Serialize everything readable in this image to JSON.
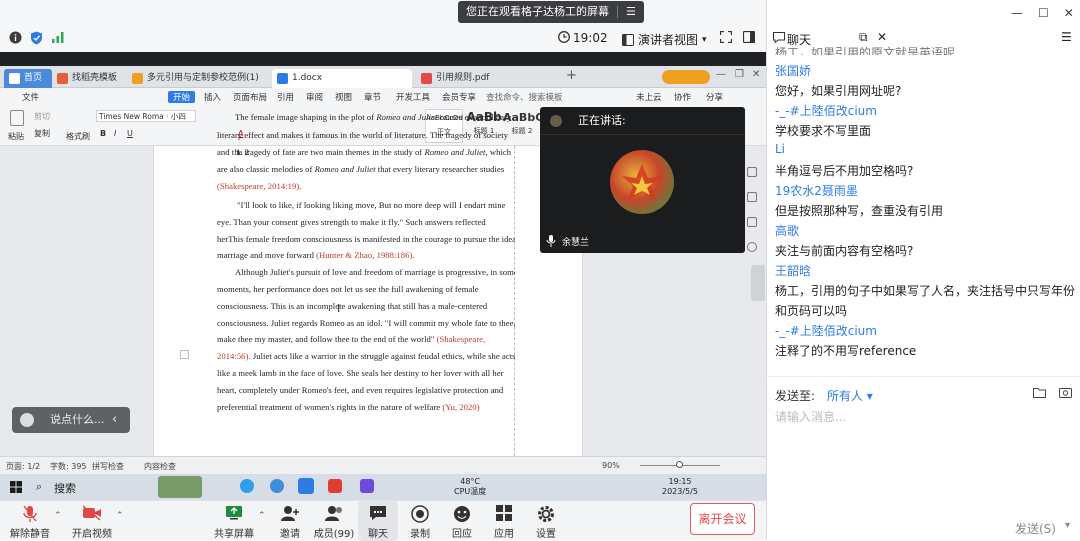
{
  "screen_share_banner": {
    "text": "您正在观看格子达杨工的屏幕"
  },
  "topbar": {
    "time": "19:02",
    "view_mode": "演讲者视图"
  },
  "browser_tabs": [
    {
      "label": "首页"
    },
    {
      "label": "找稻壳模板"
    },
    {
      "label": "多元引用与定制参校范例(1)"
    },
    {
      "label": "1.docx"
    },
    {
      "label": "引用规则.pdf"
    }
  ],
  "wps": {
    "menu": [
      "文件",
      "开始",
      "插入",
      "页面布局",
      "引用",
      "审阅",
      "视图",
      "章节",
      "开发工具",
      "会员专享",
      "查找命令、搜索模板",
      "未上云",
      "协作",
      "分享"
    ],
    "ribbon": {
      "paste": "粘贴",
      "cut": "剪切",
      "copy": "复制",
      "format_painter": "格式刷",
      "font_name": "Times New Roma",
      "font_size": "小四",
      "styles": [
        {
          "sample": "AaBbCcDd",
          "name": "正文"
        },
        {
          "sample": "AaBb",
          "name": "标题 1"
        },
        {
          "sample": "AaBbC",
          "name": "标题 2"
        }
      ]
    },
    "status": {
      "page": "页面: 1/2",
      "word_count": "字数: 395",
      "spell": "拼写检查",
      "content_check": "内容检查",
      "zoom": "90%"
    }
  },
  "document": {
    "heading": "1. 2",
    "lines": [
      {
        "parts": [
          {
            "t": "The female image shaping in the plot of "
          },
          {
            "t": "Romeo and Juliet",
            "i": true
          },
          {
            "t": " causes extraordinary"
          }
        ]
      },
      {
        "parts": [
          {
            "t": "literary effect and makes it famous in the world of literature. The tragedy of society"
          }
        ]
      },
      {
        "parts": [
          {
            "t": "and the tragedy of fate are two main themes in the study of "
          },
          {
            "t": "Romeo and Juliet",
            "i": true
          },
          {
            "t": ", which"
          }
        ]
      },
      {
        "parts": [
          {
            "t": "are also classic melodies of "
          },
          {
            "t": "Romeo and Juliet",
            "i": true
          },
          {
            "t": " that every literary researcher studies"
          }
        ]
      },
      {
        "parts": [
          {
            "t": "(Shakespeare, 2014:19).",
            "red": true
          }
        ]
      },
      {
        "parts": [
          {
            "t": "\"I'll look to like, if looking liking move, But no more deep will I endart mine"
          }
        ]
      },
      {
        "parts": [
          {
            "t": "eye. Than your consent gives strength to make it fly.\" Such answers reflected"
          }
        ]
      },
      {
        "parts": [
          {
            "t": "herThis female freedom consciousness is manifested in the courage to pursue the ideal"
          }
        ]
      },
      {
        "parts": [
          {
            "t": "marriage and move forward "
          },
          {
            "t": "(Hunter & Zhao, 1988:186).",
            "red": true
          }
        ]
      },
      {
        "parts": [
          {
            "t": "Although Juliet's pursuit of love and freedom of marriage is progressive, in some"
          }
        ]
      },
      {
        "parts": [
          {
            "t": "moments, her performance does not let us see the full awakening of female"
          }
        ]
      },
      {
        "parts": [
          {
            "t": "consciousness. This is an incomplete awakening that still has a male-centered"
          }
        ]
      },
      {
        "parts": [
          {
            "t": "consciousness. Juliet regards Romeo as an idol. \"I will commit my whole fate to thee,"
          }
        ]
      },
      {
        "parts": [
          {
            "t": "make thee my master, and follow thee to the end of the world\" "
          },
          {
            "t": "(Shakespeare,",
            "red": true
          }
        ]
      },
      {
        "parts": [
          {
            "t": "2014:56).",
            "red": true
          },
          {
            "t": " Juliet acts like a warrior in the struggle against feudal ethics, while she acts"
          }
        ]
      },
      {
        "parts": [
          {
            "t": "like a meek lamb in the face of love. She seals her destiny to her lover with all her"
          }
        ]
      },
      {
        "parts": [
          {
            "t": "heart, completely under Romeo's feet, and even requires legislative protection and"
          }
        ]
      },
      {
        "parts": [
          {
            "t": "preferential treatment of women's rights in the nature of welfare "
          },
          {
            "t": "(Yu, 2020)",
            "red": true
          }
        ]
      }
    ]
  },
  "speaker_panel": {
    "title": "正在讲话:",
    "speaker_name": "余慧兰"
  },
  "chat_pill": {
    "placeholder": "说点什么..."
  },
  "taskbar": {
    "search": "搜索",
    "weather_temp": "48°C",
    "weather_label": "CPU温度",
    "clock_time": "19:15",
    "clock_date": "2023/5/5"
  },
  "bottom_toolbar": {
    "mute": "解除静音",
    "video": "开启视频",
    "share": "共享屏幕",
    "invite": "邀请",
    "members": "成员(99)",
    "chat": "聊天",
    "record": "录制",
    "reply": "回应",
    "apps": "应用",
    "settings": "设置",
    "leave": "离开会议"
  },
  "chat": {
    "title": "聊天",
    "messages": [
      {
        "text": "杨工，如果引用的原文就是英语呢"
      },
      {
        "name": "张国娇",
        "text": "您好，如果引用网址呢?"
      },
      {
        "name": "-_-#上陸佰改cium",
        "text": "学校要求不写里面"
      },
      {
        "name": "Li",
        "text": "半角逗号后不用加空格吗?"
      },
      {
        "name": "19农水2聂雨墨",
        "text": "但是按照那种写，查重没有引用"
      },
      {
        "name": "高歌",
        "text": "夹注与前面内容有空格吗?"
      },
      {
        "name": "王韶晗",
        "text": "杨工，引用的句子中如果写了人名，夹注括号中只写年份",
        "text2": "和页码可以吗"
      },
      {
        "name": "-_-#上陸佰改cium",
        "text": "注释了的不用写reference"
      }
    ],
    "send_to_label": "发送至:",
    "send_to_target": "所有人",
    "input_placeholder": "请输入消息...",
    "send_button": "发送(S)"
  }
}
